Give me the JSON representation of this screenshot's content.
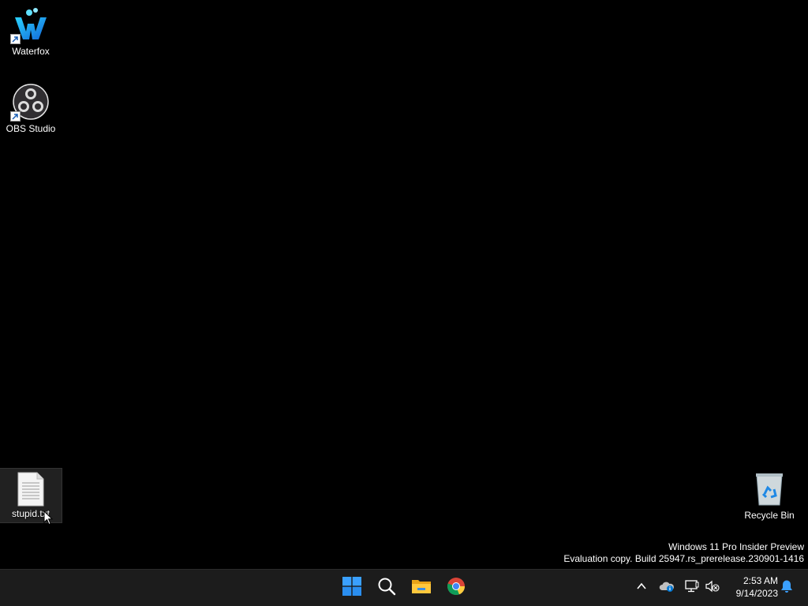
{
  "desktop": {
    "icons": [
      {
        "label": "Waterfox",
        "shortcut": true
      },
      {
        "label": "OBS Studio",
        "shortcut": true
      },
      {
        "label": "stupid.txt",
        "selected": true
      },
      {
        "label": "Recycle Bin"
      }
    ],
    "watermark": {
      "line1": "Windows 11 Pro Insider Preview",
      "line2": "Evaluation copy. Build 25947.rs_prerelease.230901-1416"
    }
  },
  "taskbar": {
    "pinned": [
      "start-icon",
      "search-icon",
      "file-explorer-icon",
      "chrome-icon"
    ],
    "tray": [
      "chevron-up-icon",
      "onedrive-icon",
      "network-icon",
      "volume-muted-icon"
    ],
    "clock": {
      "time": "2:53 AM",
      "date": "9/14/2023"
    },
    "colors": {
      "background": "#1c1c1c",
      "accent": "#0078d4",
      "notification": "#3aa0ff"
    }
  }
}
